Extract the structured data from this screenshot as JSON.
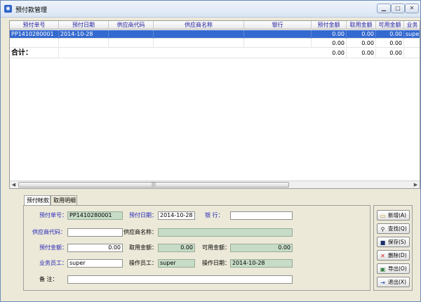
{
  "window": {
    "title": "预付款管理"
  },
  "table": {
    "headers": [
      "预付单号",
      "预付日期",
      "供应商代码",
      "供应商名称",
      "银行",
      "预付金额",
      "取用金额",
      "可用金额",
      "业务"
    ],
    "rows": [
      [
        "PP1410280001",
        "2014-10-28",
        "",
        "",
        "",
        "0.00",
        "0.00",
        "0.00",
        "super"
      ],
      [
        "",
        "",
        "",
        "",
        "",
        "0.00",
        "0.00",
        "0.00",
        ""
      ]
    ],
    "total": {
      "label": "合计：",
      "values": [
        "0.00",
        "0.00",
        "0.00"
      ]
    }
  },
  "tabs": [
    "预付帐款",
    "取用明细"
  ],
  "form": {
    "order_no_label": "预付单号：",
    "order_no": "PP1410280001",
    "date_label": "预付日期：",
    "date": "2014-10-28",
    "bank_label": "银  行：",
    "bank": "",
    "supplier_code_label": "供应商代码：",
    "supplier_code": "",
    "supplier_name_label": "供应商名称：",
    "supplier_name": "",
    "amount_label": "预付金额：",
    "amount": "0.00",
    "used_label": "取用金额：",
    "used": "0.00",
    "available_label": "可用金额：",
    "available": "0.00",
    "staff_label": "业务员工：",
    "staff": "super",
    "operator_label": "操作员工：",
    "operator": "super",
    "op_date_label": "操作日期：",
    "op_date": "2014-10-28",
    "remark_label": "备  注：",
    "remark": ""
  },
  "actions": [
    {
      "label": "新增(A)",
      "icon": "folder-icon"
    },
    {
      "label": "查找(Q)",
      "icon": "search-icon"
    },
    {
      "label": "保存(S)",
      "icon": "save-icon"
    },
    {
      "label": "删除(D)",
      "icon": "delete-icon"
    },
    {
      "label": "导出(O)",
      "icon": "export-icon"
    },
    {
      "label": "退出(X)",
      "icon": "exit-icon"
    }
  ],
  "colors": {
    "selection": "#3469cf",
    "readonly": "#c7dcc7",
    "header_text": "#1a1a9c",
    "label_blue": "#2424b8"
  }
}
